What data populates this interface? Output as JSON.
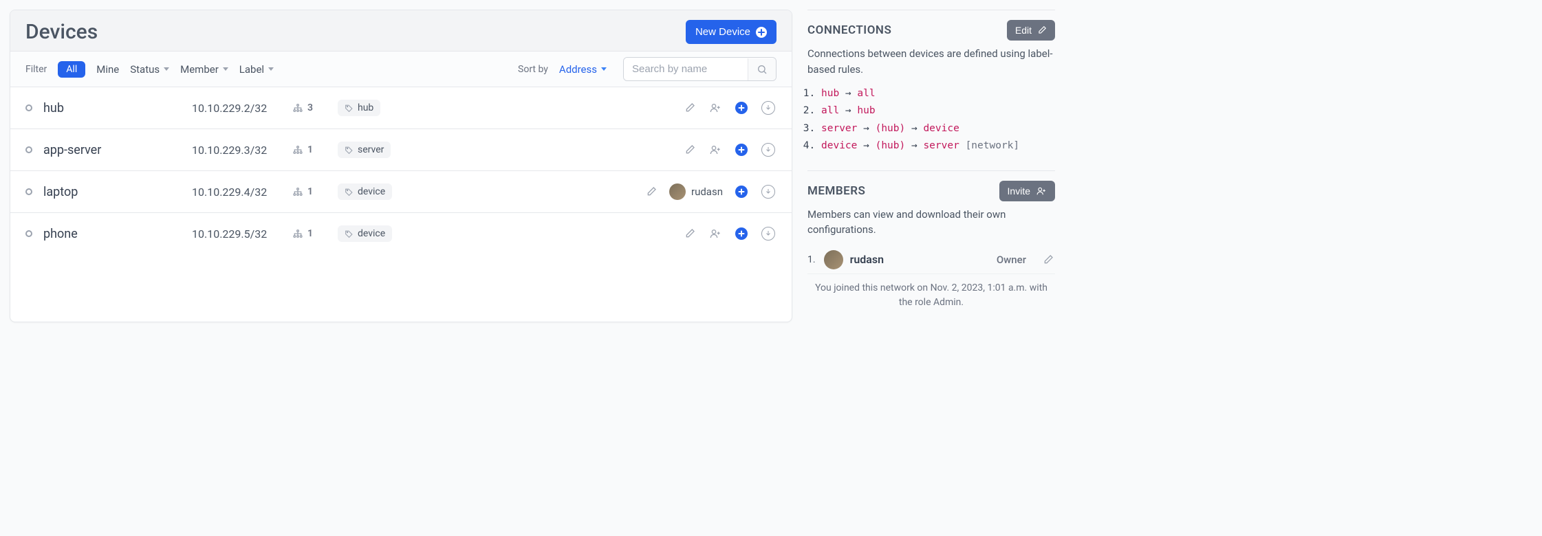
{
  "header": {
    "title": "Devices",
    "new_device_label": "New Device"
  },
  "filters": {
    "label": "Filter",
    "all": "All",
    "mine": "Mine",
    "status": "Status",
    "member": "Member",
    "tag": "Label"
  },
  "sort": {
    "label": "Sort by",
    "value": "Address"
  },
  "search": {
    "placeholder": "Search by name"
  },
  "devices": [
    {
      "name": "hub",
      "ip": "10.10.229.2/32",
      "peers": "3",
      "tag": "hub",
      "user": null
    },
    {
      "name": "app-server",
      "ip": "10.10.229.3/32",
      "peers": "1",
      "tag": "server",
      "user": null
    },
    {
      "name": "laptop",
      "ip": "10.10.229.4/32",
      "peers": "1",
      "tag": "device",
      "user": "rudasn"
    },
    {
      "name": "phone",
      "ip": "10.10.229.5/32",
      "peers": "1",
      "tag": "device",
      "user": null
    }
  ],
  "connections": {
    "title": "CONNECTIONS",
    "edit": "Edit",
    "desc": "Connections between devices are defined using label-based rules.",
    "rules": [
      {
        "a": "hub",
        "mid": null,
        "b": "all",
        "suffix": null
      },
      {
        "a": "all",
        "mid": null,
        "b": "hub",
        "suffix": null
      },
      {
        "a": "server",
        "mid": "(hub)",
        "b": "device",
        "suffix": null
      },
      {
        "a": "device",
        "mid": "(hub)",
        "b": "server",
        "suffix": "[network]"
      }
    ]
  },
  "members": {
    "title": "MEMBERS",
    "invite": "Invite",
    "desc": "Members can view and download their own configurations.",
    "list": [
      {
        "idx": "1.",
        "name": "rudasn",
        "role": "Owner"
      }
    ],
    "footnote": "You joined this network on Nov. 2, 2023, 1:01 a.m. with the role Admin."
  }
}
